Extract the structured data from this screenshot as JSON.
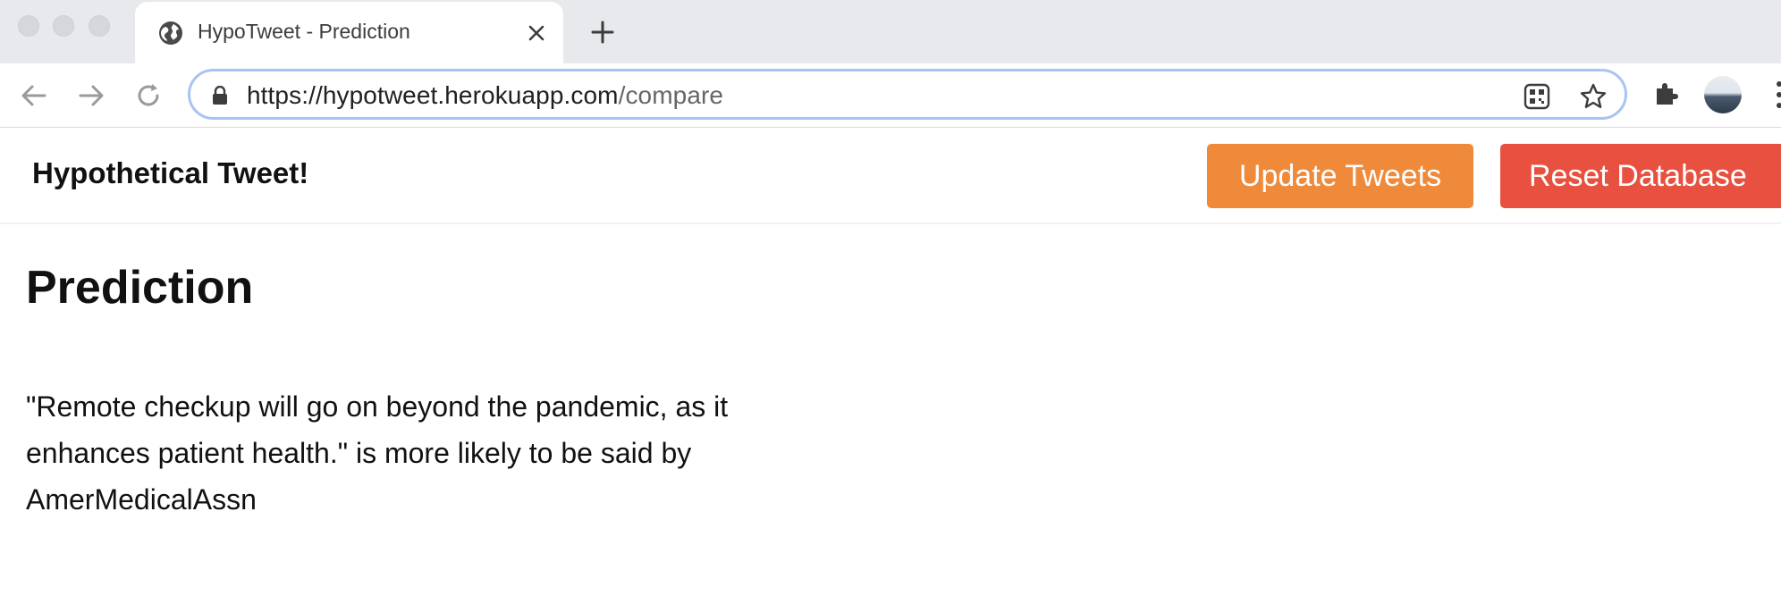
{
  "browser": {
    "tab_title": "HypoTweet - Prediction",
    "url_host": "https://hypotweet.herokuapp.com",
    "url_path": "/compare"
  },
  "navbar": {
    "brand": "Hypothetical Tweet!",
    "update_label": "Update Tweets",
    "reset_label": "Reset Database",
    "colors": {
      "update": "#ef8a3a",
      "reset": "#e8503f"
    }
  },
  "main": {
    "title": "Prediction",
    "result_text": "\"Remote checkup will go on beyond the pandemic, as it enhances patient health.\" is more likely to be said by AmerMedicalAssn"
  },
  "icons": [
    "globe-icon",
    "close-icon",
    "plus-icon",
    "back-icon",
    "forward-icon",
    "reload-icon",
    "lock-icon",
    "qr-code-icon",
    "star-icon",
    "extensions-icon",
    "menu-icon"
  ]
}
